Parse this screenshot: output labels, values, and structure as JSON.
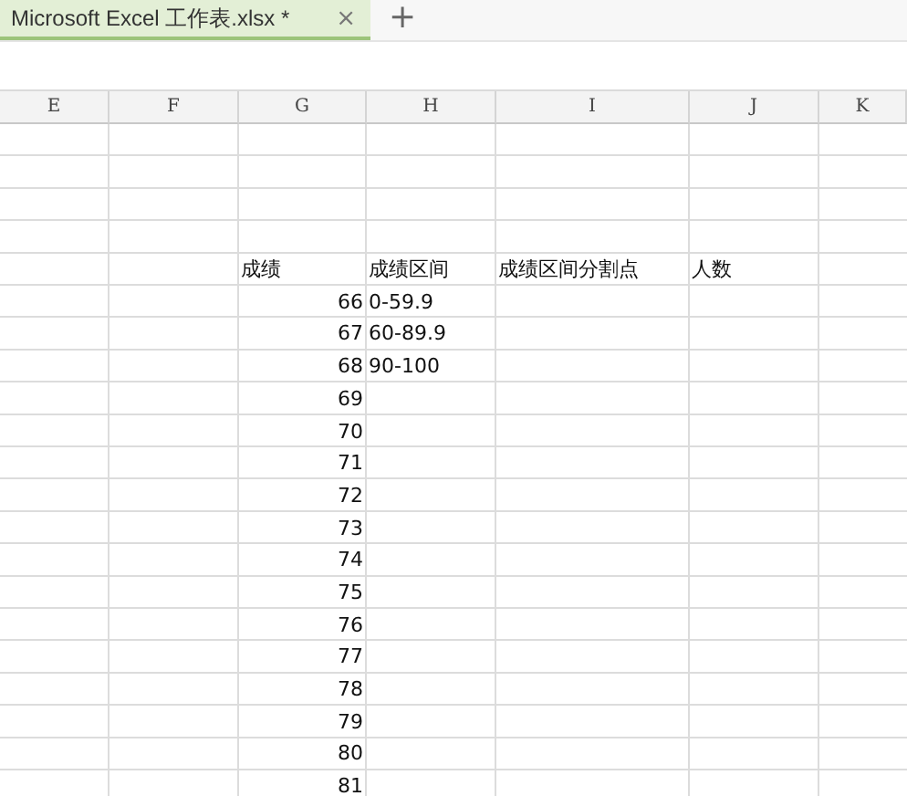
{
  "tabs": [
    {
      "label": "Microsoft Excel 工作表.xlsx *",
      "close": "×",
      "selected": true
    }
  ],
  "new_tab": "+",
  "columns": [
    "E",
    "F",
    "G",
    "H",
    "I",
    "J",
    "K"
  ],
  "rows": [
    {},
    {},
    {},
    {},
    {
      "G": "成绩",
      "H": "成绩区间",
      "I": "成绩区间分割点",
      "J": "人数"
    },
    {
      "G": "66",
      "H": "0-59.9"
    },
    {
      "G": "67",
      "H": "60-89.9"
    },
    {
      "G": "68",
      "H": "90-100"
    },
    {
      "G": "69"
    },
    {
      "G": "70"
    },
    {
      "G": "71"
    },
    {
      "G": "72"
    },
    {
      "G": "73"
    },
    {
      "G": "74"
    },
    {
      "G": "75"
    },
    {
      "G": "76"
    },
    {
      "G": "77"
    },
    {
      "G": "78"
    },
    {
      "G": "79"
    },
    {
      "G": "80"
    },
    {
      "G": "81"
    }
  ]
}
